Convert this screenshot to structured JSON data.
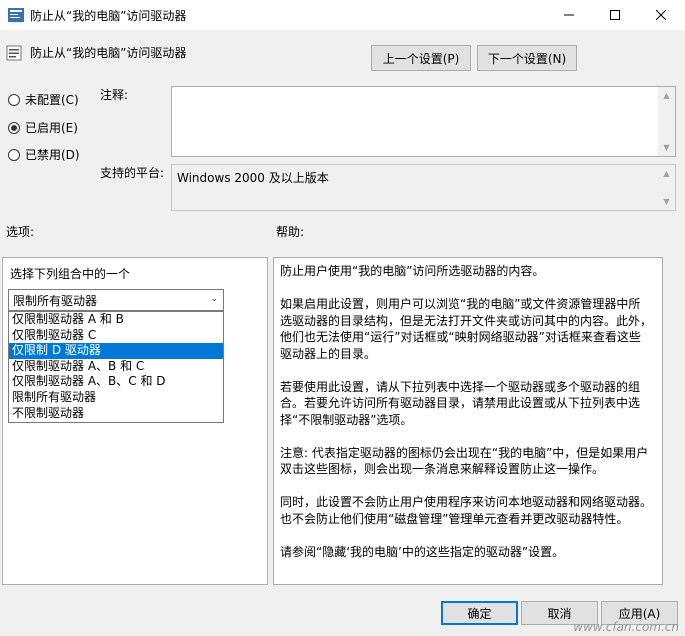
{
  "window": {
    "title": "防止从“我的电脑”访问驱动器",
    "minimize_icon": "minimize-icon",
    "maximize_icon": "maximize-icon",
    "close_icon": "close-icon"
  },
  "header": {
    "title": "防止从“我的电脑”访问驱动器",
    "prev_button": "上一个设置(P)",
    "next_button": "下一个设置(N)"
  },
  "state": {
    "options": [
      {
        "label": "未配置(C)",
        "checked": false
      },
      {
        "label": "已启用(E)",
        "checked": true
      },
      {
        "label": "已禁用(D)",
        "checked": false
      }
    ]
  },
  "comment": {
    "label": "注释:",
    "value": ""
  },
  "platform": {
    "label": "支持的平台:",
    "value": "Windows 2000 及以上版本"
  },
  "options_section": {
    "label": "选项:",
    "combo_caption": "选择下列组合中的一个",
    "selected_value": "限制所有驱动器",
    "dropdown_items": [
      {
        "label": "仅限制驱动器 A 和 B",
        "selected": false
      },
      {
        "label": "仅限制驱动器 C",
        "selected": false
      },
      {
        "label": "仅限制 D 驱动器",
        "selected": true
      },
      {
        "label": "仅限制驱动器 A、B 和 C",
        "selected": false
      },
      {
        "label": "仅限制驱动器 A、B、C 和 D",
        "selected": false
      },
      {
        "label": "限制所有驱动器",
        "selected": false
      },
      {
        "label": "不限制驱动器",
        "selected": false
      }
    ]
  },
  "help_section": {
    "label": "帮助:",
    "paragraphs": [
      "防止用户使用“我的电脑”访问所选驱动器的内容。",
      "如果启用此设置，则用户可以浏览“我的电脑”或文件资源管理器中所选驱动器的目录结构，但是无法打开文件夹或访问其中的内容。此外，他们也无法使用“运行”对话框或“映射网络驱动器”对话框来查看这些驱动器上的目录。",
      "若要使用此设置，请从下拉列表中选择一个驱动器或多个驱动器的组合。若要允许访问所有驱动器目录，请禁用此设置或从下拉列表中选择“不限制驱动器”选项。",
      "注意: 代表指定驱动器的图标仍会出现在“我的电脑”中，但是如果用户双击这些图标，则会出现一条消息来解释设置防止这一操作。",
      " 同时，此设置不会防止用户使用程序来访问本地驱动器和网络驱动器。也不会防止他们使用“磁盘管理”管理单元查看并更改驱动器特性。",
      "请参阅“隐藏‘我的电脑’中的这些指定的驱动器”设置。"
    ]
  },
  "footer": {
    "ok": "确定",
    "cancel": "取消",
    "apply": "应用(A)"
  },
  "watermark": "www.cfan.com.cn"
}
